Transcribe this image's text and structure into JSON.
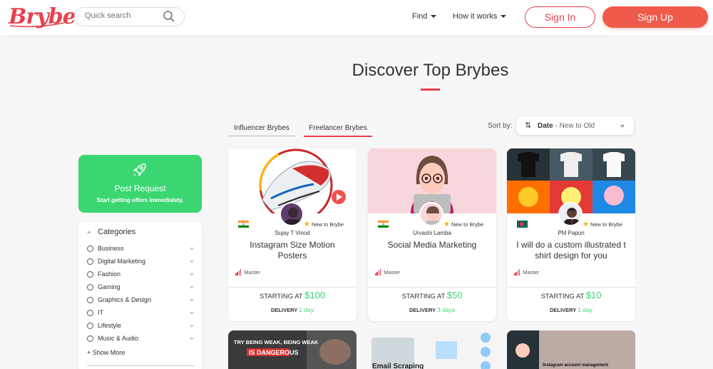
{
  "header": {
    "logo": "Brybe...",
    "search_placeholder": "Quick search",
    "nav": [
      {
        "label": "Find"
      },
      {
        "label": "How it works"
      }
    ],
    "sign_in": "Sign In",
    "sign_up": "Sign Up"
  },
  "page": {
    "title": "Discover Top Brybes"
  },
  "tabs": [
    {
      "label": "Influencer Brybes"
    },
    {
      "label": "Freelancer Brybes",
      "active": true
    }
  ],
  "sort": {
    "label": "Sort by:",
    "value": "Date",
    "value_sub": "- New to Old"
  },
  "post_request": {
    "title": "Post Request",
    "subtitle": "Start getting offers immediately."
  },
  "categories": {
    "header": "Categories",
    "items": [
      {
        "label": "Business"
      },
      {
        "label": "Digital Marketing"
      },
      {
        "label": "Fashion"
      },
      {
        "label": "Gaming"
      },
      {
        "label": "Graphics & Design"
      },
      {
        "label": "IT"
      },
      {
        "label": "Lifestyle"
      },
      {
        "label": "Music & Audio"
      }
    ],
    "show_more": "+ Show More"
  },
  "cards": [
    {
      "seller": "Sujay T Vinod",
      "badge": "New to Brybe",
      "title": "Instagram Size Motion Posters",
      "level": "Master",
      "starting_label": "STARTING AT",
      "price": "$100",
      "delivery_label": "DELIVERY",
      "delivery_days": "1 day"
    },
    {
      "seller": "Urvashi Lamba",
      "badge": "New to Brybe",
      "title": "Social Media Marketing",
      "level": "Master",
      "starting_label": "STARTING AT",
      "price": "$50",
      "delivery_label": "DELIVERY",
      "delivery_days": "3 days"
    },
    {
      "seller": "PM Papon",
      "badge": "New to Brybe",
      "title": "I will do a custom illustrated t shirt design for you",
      "level": "Master",
      "starting_label": "STARTING AT",
      "price": "$10",
      "delivery_label": "DELIVERY",
      "delivery_days": "1 day"
    }
  ],
  "bottom_cards": [
    {
      "thumb_text": [
        "TRY BEING WEAK, BEING WEAK",
        "IS DANGEROUS"
      ]
    },
    {
      "thumb_text": [
        "Email Scraping"
      ]
    },
    {
      "thumb_text": [
        "Instagram account management"
      ]
    }
  ],
  "colors": {
    "brand": "#e8414f",
    "signup": "#f05a4a",
    "green": "#3bd672"
  }
}
